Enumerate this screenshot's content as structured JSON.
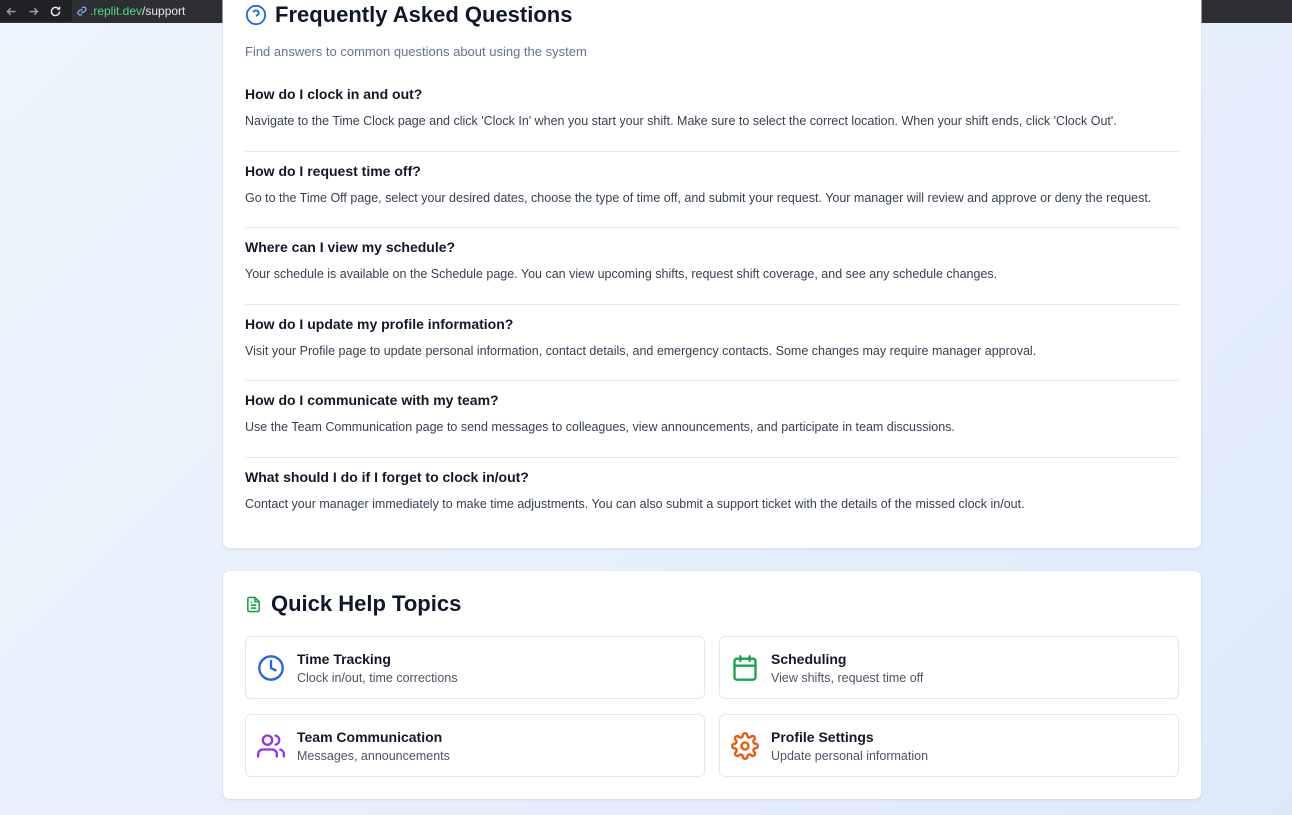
{
  "browser": {
    "url_host": ".replit.dev",
    "url_path": "/support"
  },
  "faq": {
    "title": "Frequently Asked Questions",
    "subtitle": "Find answers to common questions about using the system",
    "items": [
      {
        "question": "How do I clock in and out?",
        "answer": "Navigate to the Time Clock page and click 'Clock In' when you start your shift. Make sure to select the correct location. When your shift ends, click 'Clock Out'."
      },
      {
        "question": "How do I request time off?",
        "answer": "Go to the Time Off page, select your desired dates, choose the type of time off, and submit your request. Your manager will review and approve or deny the request."
      },
      {
        "question": "Where can I view my schedule?",
        "answer": "Your schedule is available on the Schedule page. You can view upcoming shifts, request shift coverage, and see any schedule changes."
      },
      {
        "question": "How do I update my profile information?",
        "answer": "Visit your Profile page to update personal information, contact details, and emergency contacts. Some changes may require manager approval."
      },
      {
        "question": "How do I communicate with my team?",
        "answer": "Use the Team Communication page to send messages to colleagues, view announcements, and participate in team discussions."
      },
      {
        "question": "What should I do if I forget to clock in/out?",
        "answer": "Contact your manager immediately to make time adjustments. You can also submit a support ticket with the details of the missed clock in/out."
      }
    ]
  },
  "help": {
    "title": "Quick Help Topics",
    "topics": [
      {
        "title": "Time Tracking",
        "description": "Clock in/out, time corrections",
        "icon": "clock-icon",
        "color": "#2563eb"
      },
      {
        "title": "Scheduling",
        "description": "View shifts, request time off",
        "icon": "calendar-icon",
        "color": "#16a34a"
      },
      {
        "title": "Team Communication",
        "description": "Messages, announcements",
        "icon": "users-icon",
        "color": "#9333ea"
      },
      {
        "title": "Profile Settings",
        "description": "Update personal information",
        "icon": "gear-icon",
        "color": "#ea580c"
      }
    ]
  }
}
